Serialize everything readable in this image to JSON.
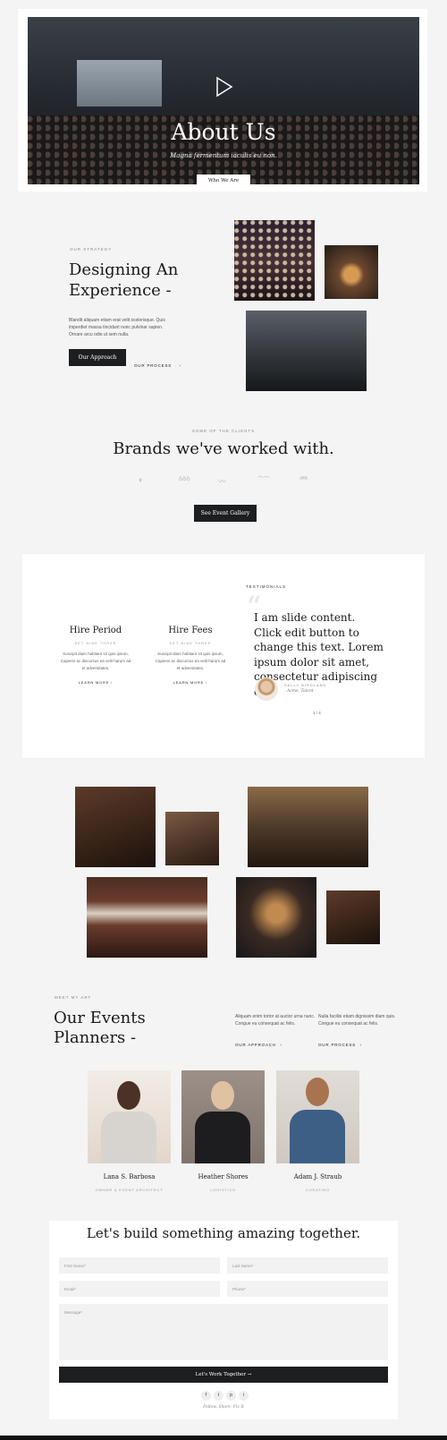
{
  "hero": {
    "title": "About Us",
    "subtitle": "Magna fermentum iaculis eu non.",
    "button": "Who We Are"
  },
  "experience": {
    "eyebrow": "OUR STRATEGY",
    "title_line1": "Designing An",
    "title_line2": "Experience -",
    "body_line1": "Blandit aliquam etiam erat velit scelerisque. Quis",
    "body_line2": "imperdiet massa tincidunt nunc pulvinar sapien.",
    "body_line3": "Ornare arcu odio ut sem nulla.",
    "primary_button": "Our Approach",
    "secondary_link": "OUR PROCESS",
    "arrow": "›"
  },
  "brands": {
    "eyebrow": "SOME OF THE CLIENTS",
    "title": "Brands we've worked with.",
    "logos": [
      "logo-1",
      "logo-2",
      "logo-3",
      "logo-4",
      "logo-5"
    ],
    "button": "See Event Gallery"
  },
  "services": {
    "items": [
      {
        "title": "Hire Period",
        "eyebrow": "SET NINE THREE",
        "body_line1": "Suscipit diam habitant sit quis ipsum,",
        "body_line2": "Capiens ac discursus ea velit harum ad",
        "body_line3": "et adversitates.",
        "link": "LEARN MORE"
      },
      {
        "title": "Hire Fees",
        "eyebrow": "SET NINE THREE",
        "body_line1": "Suscipit diam habitant sit quis ipsum,",
        "body_line2": "Capiens ac discursus ea velit harum ad",
        "body_line3": "et adversitates.",
        "link": "LEARN MORE"
      }
    ]
  },
  "testimonial": {
    "eyebrow": "TESTIMONIALS",
    "quote_mark": "“",
    "quote": "I am slide content. Click edit button to change this text. Lorem ipsum dolor sit amet, consectetur adipiscing elit.",
    "author_name": "SALLY BIRDLAND",
    "author_role": "- Acme, Talent -",
    "pager": "1 / 4"
  },
  "planners": {
    "eyebrow": "MEET MY ART",
    "title_line1": "Our Events",
    "title_line2": "Planners -",
    "col1_line1": "Aliquam enim tortor at auctor urna nunc.",
    "col1_line2": "Congue eu consequat ac felis.",
    "col1_link": "OUR APPROACH",
    "col2_line1": "Nulla facilisi etiam dignissim diam quis.",
    "col2_line2": "Congue eu consequat ac felis.",
    "col2_link": "OUR PROCESS",
    "people": [
      {
        "name": "Lana S. Barbosa",
        "role": "OWNER & EVENT ARCHITECT"
      },
      {
        "name": "Heather Shores",
        "role": "LOGISTICS"
      },
      {
        "name": "Adam J. Straub",
        "role": "CURATING"
      }
    ]
  },
  "contact": {
    "title": "Let's build something amazing together.",
    "first_name": "First Name*",
    "last_name": "Last Name*",
    "email": "Email*",
    "phone": "Phone*",
    "message": "Message*",
    "submit": "Let's Work Together →",
    "socials": [
      "f",
      "t",
      "p",
      "i"
    ],
    "tagline": "Follow, Share, Fix It"
  }
}
